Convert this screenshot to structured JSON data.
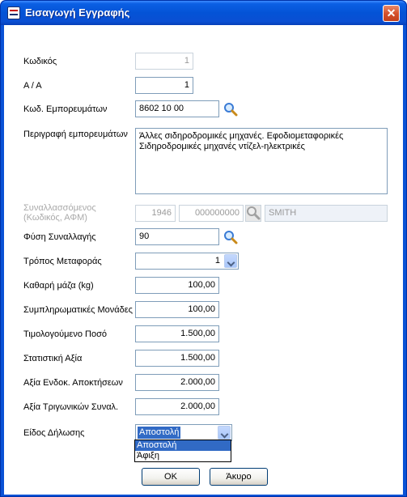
{
  "window": {
    "title": "Εισαγωγή Εγγραφής",
    "close_glyph": "✕"
  },
  "form": {
    "kodikos": {
      "label": "Κωδικός",
      "value": "1"
    },
    "aa": {
      "label": "Α / Α",
      "value": "1"
    },
    "kod_emporeumaton": {
      "label": "Κωδ. Εμπορευμάτων",
      "value": "8602 10 00"
    },
    "perigrafi": {
      "label": "Περιγραφή εμπορευμάτων",
      "lines": [
        "Άλλες σιδηροδρομικές μηχανές. Εφοδιομεταφορικές",
        "Σιδηροδρομικές μηχανές ντίζελ-ηλεκτρικές"
      ]
    },
    "synallassomenos": {
      "label_line1": "Συναλλασσόμενος",
      "label_line2": "(Κωδικός, ΑΦΜ)",
      "code": "1946",
      "afm": "000000000",
      "name": "SMITH"
    },
    "fysi_synallagis": {
      "label": "Φύση Συναλλαγής",
      "value": "90"
    },
    "tropos_metaforas": {
      "label": "Τρόπος Μεταφοράς",
      "value": "1"
    },
    "kathari_maza": {
      "label": "Καθαρή μάζα (kg)",
      "value": "100,00"
    },
    "sympliromatikes": {
      "label": "Συμπληρωματικές Μονάδες",
      "value": "100,00"
    },
    "timologoumeno": {
      "label": "Τιμολογούμενο Ποσό",
      "value": "1.500,00"
    },
    "statistiki": {
      "label": "Στατιστική Αξία",
      "value": "1.500,00"
    },
    "endok": {
      "label": "Αξία Ενδοκ. Αποκτήσεων",
      "value": "2.000,00"
    },
    "trigonikon": {
      "label": "Αξία Τριγωνικών Συναλ.",
      "value": "2.000,00"
    },
    "eidos_dilosis": {
      "label": "Είδος Δήλωσης",
      "value": "Αποστολή",
      "options": [
        "Αποστολή",
        "Άφιξη"
      ]
    }
  },
  "buttons": {
    "ok": "OK",
    "cancel": "Άκυρο"
  },
  "icons": {
    "search": "search-icon",
    "close": "close-icon",
    "dropdown": "chevron-down-icon",
    "app": "app-icon"
  },
  "colors": {
    "titlebar": "#0453d6",
    "field_border": "#7f9db9",
    "selection": "#316ac5",
    "close_button": "#d5522d"
  }
}
